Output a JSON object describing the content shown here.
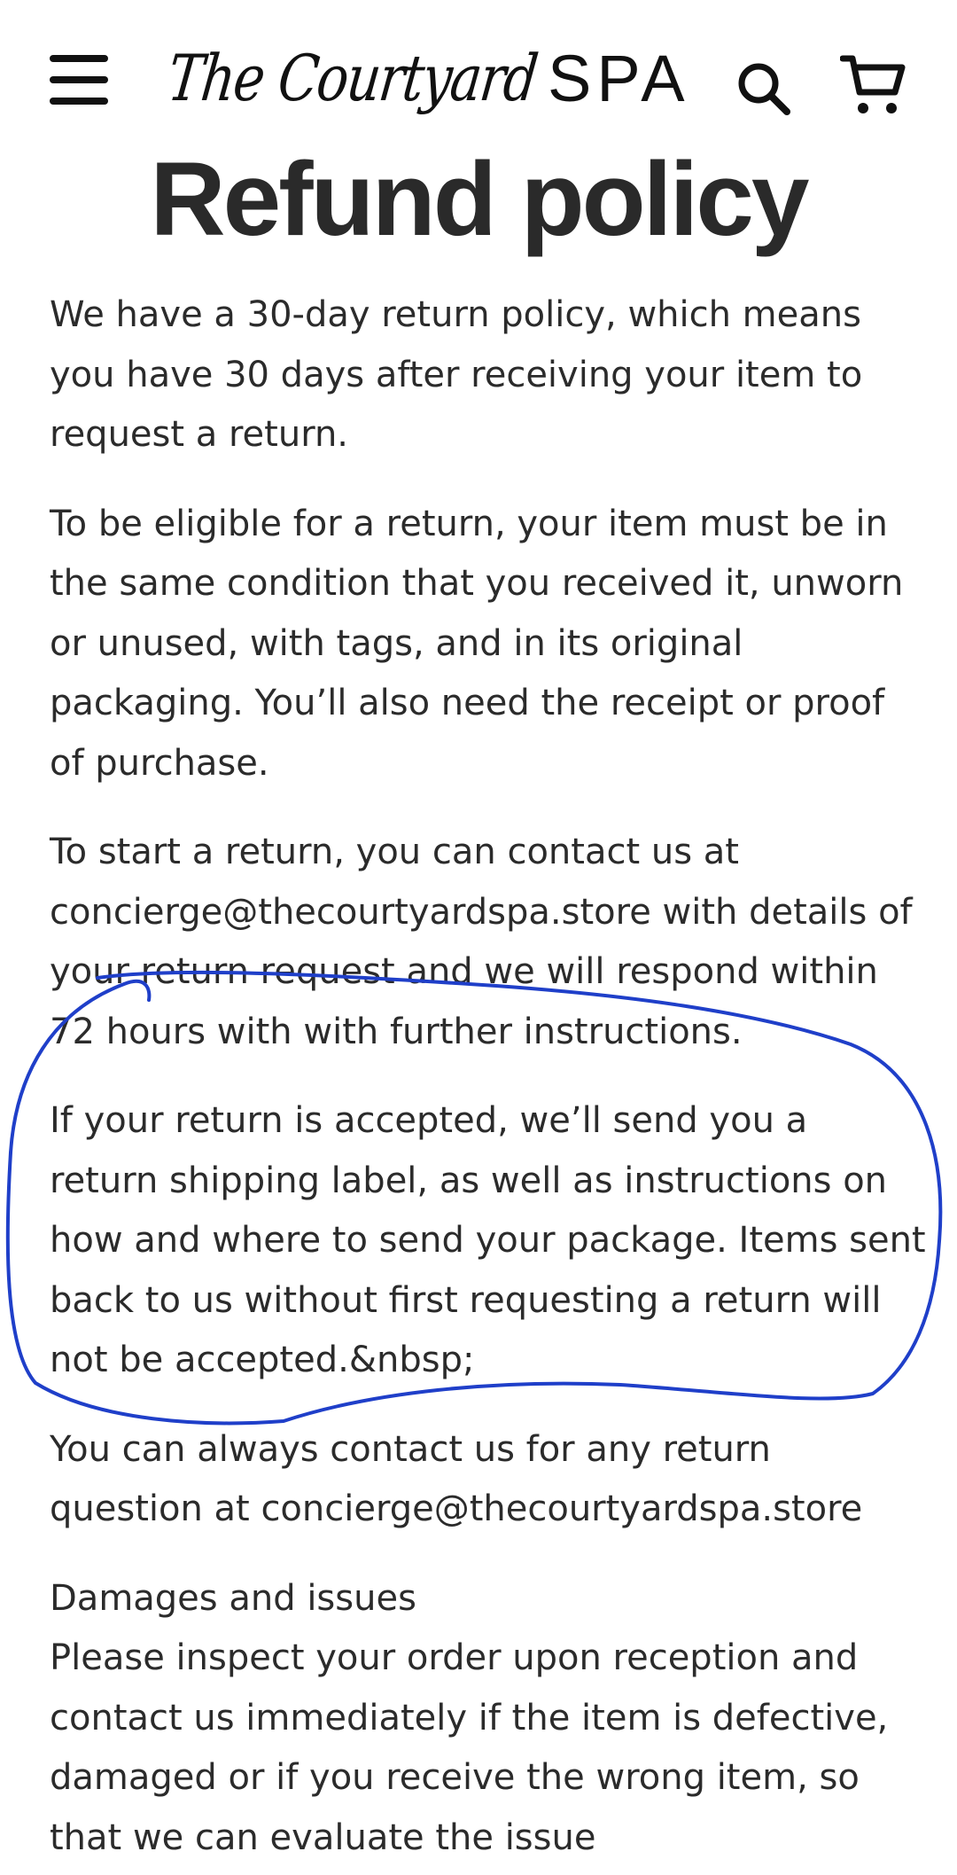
{
  "header": {
    "menu_icon": "hamburger-menu-icon",
    "logo_script": "The Courtyard",
    "logo_word": "SPA",
    "search_icon": "search-icon",
    "cart_icon": "cart-icon"
  },
  "page": {
    "title": "Refund policy"
  },
  "policy": {
    "p1": "We have a 30-day return policy, which means you have 30 days after receiving your item to request a return.",
    "p2": "To be eligible for a return, your item must be in the same condition that you received it, unworn or unused, with tags, and in its original packaging. You’ll also need the receipt or proof of purchase.",
    "p3_before": "To start a return, you can contact us at ",
    "p3_email": "concierge@thecourtyardspa.store",
    "p3_after": " with details of your return request and we will respond within 72 hours with with further instructions.",
    "p4": "If your return is accepted, we’ll send you a return shipping label, as well as instructions on how and where to send your package. Items sent back to us without first requesting a return will not be accepted.&nbsp;",
    "p5_before": "You can always contact us for any return question at ",
    "p5_email": "concierge@thecourtyardspa.store",
    "damages_heading": "Damages and issues",
    "damages_text": "Please inspect your order upon reception and contact us immediately if the item is defective, damaged or if you receive the wrong item, so that we can evaluate the issue"
  },
  "colors": {
    "text": "#2b2b2b",
    "annotation_stroke": "#1f3fc9"
  }
}
